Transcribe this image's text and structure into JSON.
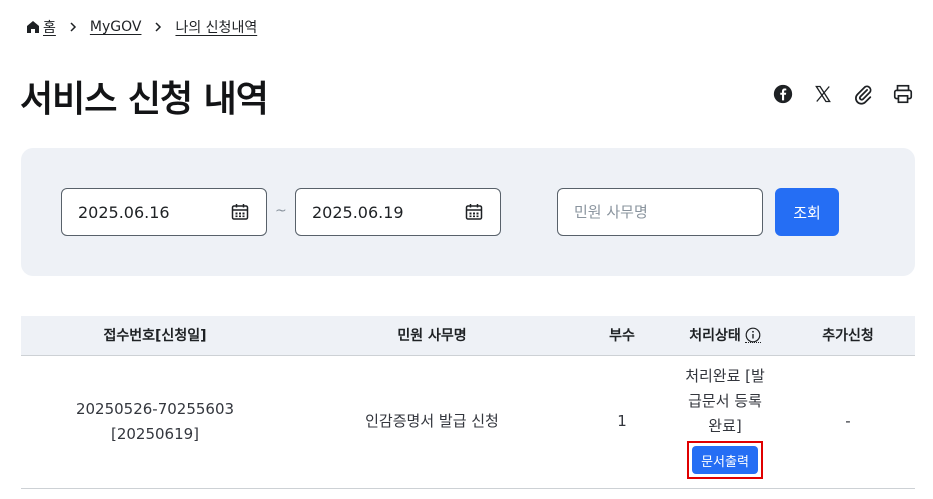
{
  "breadcrumb": {
    "home": "홈",
    "level1": "MyGOV",
    "level2": "나의 신청내역"
  },
  "page": {
    "title": "서비스 신청 내역"
  },
  "share": {
    "icons": [
      "facebook-icon",
      "x-icon",
      "link-icon",
      "print-icon"
    ]
  },
  "search": {
    "start_date": "2025.06.16",
    "end_date": "2025.06.19",
    "tilde": "~",
    "service_placeholder": "민원 사무명",
    "service_value": "",
    "submit_label": "조회"
  },
  "table": {
    "headers": {
      "receipt": "접수번호[신청일]",
      "service": "민원 사무명",
      "copies": "부수",
      "status": "처리상태",
      "extra": "추가신청"
    },
    "rows": [
      {
        "receipt_no": "20250526-70255603",
        "apply_date": "[20250619]",
        "service": "인감증명서 발급 신청",
        "copies": "1",
        "status": "처리완료 [발급문서 등록완료]",
        "action": "문서출력",
        "extra": "-"
      }
    ]
  },
  "colors": {
    "accent": "#256ef4",
    "panel_bg": "#eef1f6",
    "highlight_border": "#e00000"
  }
}
